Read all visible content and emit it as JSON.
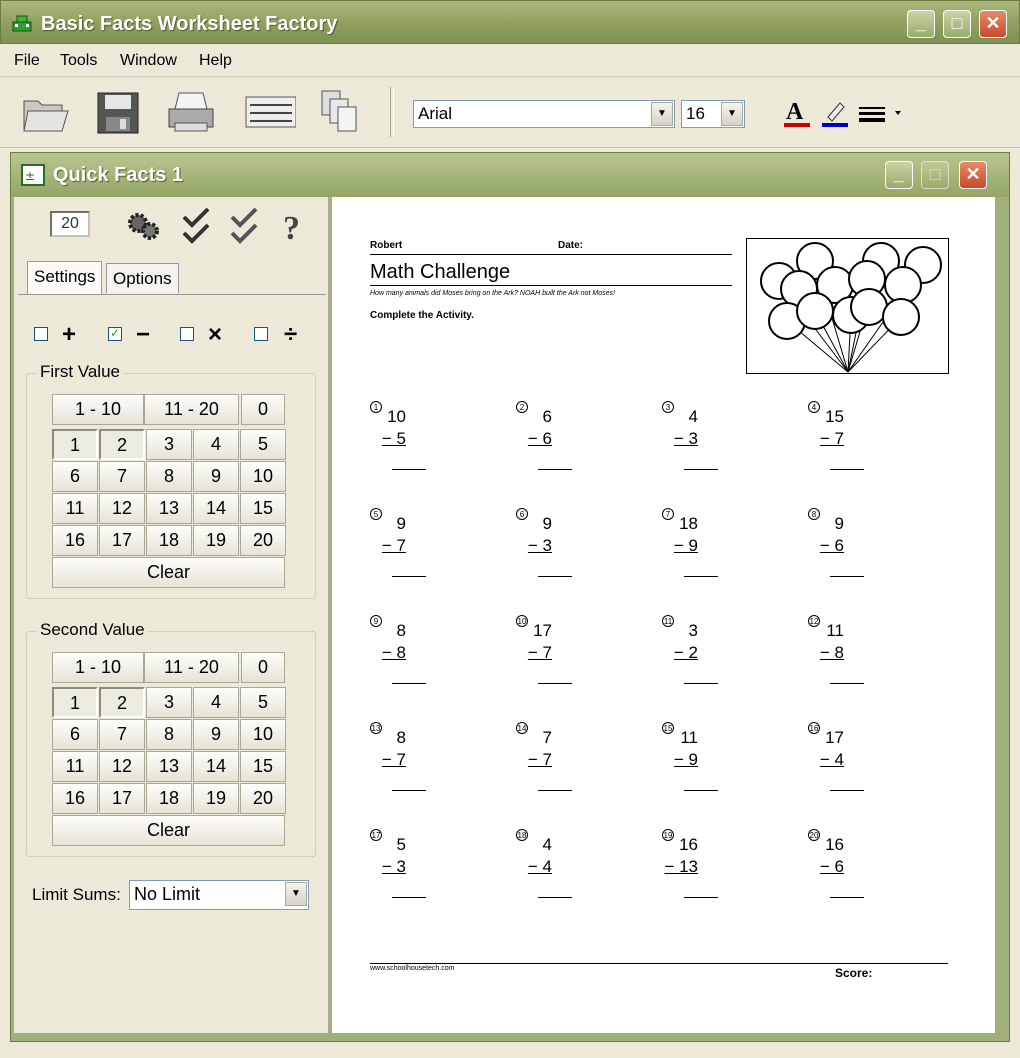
{
  "app": {
    "title": "Basic Facts Worksheet Factory",
    "minimize": "_",
    "maximize": "□",
    "close": "✕"
  },
  "menu": [
    "File",
    "Tools",
    "Window",
    "Help"
  ],
  "toolbar": {
    "icons": [
      "open-folder-icon",
      "save-disk-icon",
      "print-icon",
      "worksheet-icon",
      "copies-icon"
    ],
    "font": "Arial",
    "font_size": "16",
    "font_color": "#cc0000",
    "highlight_color": "#0000cc"
  },
  "doc_window": {
    "title": "Quick Facts 1"
  },
  "settings": {
    "count": "20",
    "tabs": [
      "Settings",
      "Options"
    ],
    "operations": [
      {
        "symbol": "+",
        "checked": false
      },
      {
        "symbol": "−",
        "checked": true
      },
      {
        "symbol": "×",
        "checked": false
      },
      {
        "symbol": "÷",
        "checked": false
      }
    ],
    "first_value": {
      "label": "First Value",
      "ranges": [
        "1 - 10",
        "11 - 20",
        "0"
      ],
      "numbers": [
        "1",
        "2",
        "3",
        "4",
        "5",
        "6",
        "7",
        "8",
        "9",
        "10",
        "11",
        "12",
        "13",
        "14",
        "15",
        "16",
        "17",
        "18",
        "19",
        "20"
      ],
      "clear": "Clear"
    },
    "second_value": {
      "label": "Second Value",
      "ranges": [
        "1 - 10",
        "11 - 20",
        "0"
      ],
      "numbers": [
        "1",
        "2",
        "3",
        "4",
        "5",
        "6",
        "7",
        "8",
        "9",
        "10",
        "11",
        "12",
        "13",
        "14",
        "15",
        "16",
        "17",
        "18",
        "19",
        "20"
      ],
      "clear": "Clear"
    },
    "limit_label": "Limit Sums:",
    "limit_value": "No Limit"
  },
  "worksheet": {
    "name": "Robert",
    "date_label": "Date:",
    "title": "Math Challenge",
    "subtitle": "How many animals did Moses bring on the Ark? NOAH built the Ark not Moses!",
    "instructions": "Complete the Activity.",
    "problems": [
      {
        "n": "1",
        "top": "10",
        "bottom": "− 5"
      },
      {
        "n": "2",
        "top": "6",
        "bottom": "− 6"
      },
      {
        "n": "3",
        "top": "4",
        "bottom": "− 3"
      },
      {
        "n": "4",
        "top": "15",
        "bottom": "− 7"
      },
      {
        "n": "5",
        "top": "9",
        "bottom": "− 7"
      },
      {
        "n": "6",
        "top": "9",
        "bottom": "− 3"
      },
      {
        "n": "7",
        "top": "18",
        "bottom": "− 9"
      },
      {
        "n": "8",
        "top": "9",
        "bottom": "− 6"
      },
      {
        "n": "9",
        "top": "8",
        "bottom": "− 8"
      },
      {
        "n": "10",
        "top": "17",
        "bottom": "− 7"
      },
      {
        "n": "11",
        "top": "3",
        "bottom": "− 2"
      },
      {
        "n": "12",
        "top": "11",
        "bottom": "− 8"
      },
      {
        "n": "13",
        "top": "8",
        "bottom": "− 7"
      },
      {
        "n": "14",
        "top": "7",
        "bottom": "− 7"
      },
      {
        "n": "15",
        "top": "11",
        "bottom": "− 9"
      },
      {
        "n": "16",
        "top": "17",
        "bottom": "− 4"
      },
      {
        "n": "17",
        "top": "5",
        "bottom": "− 3"
      },
      {
        "n": "18",
        "top": "4",
        "bottom": "− 4"
      },
      {
        "n": "19",
        "top": "16",
        "bottom": "− 13"
      },
      {
        "n": "20",
        "top": "16",
        "bottom": "− 6"
      }
    ],
    "footer_url": "www.schoolhousetech.com",
    "score_label": "Score:"
  }
}
